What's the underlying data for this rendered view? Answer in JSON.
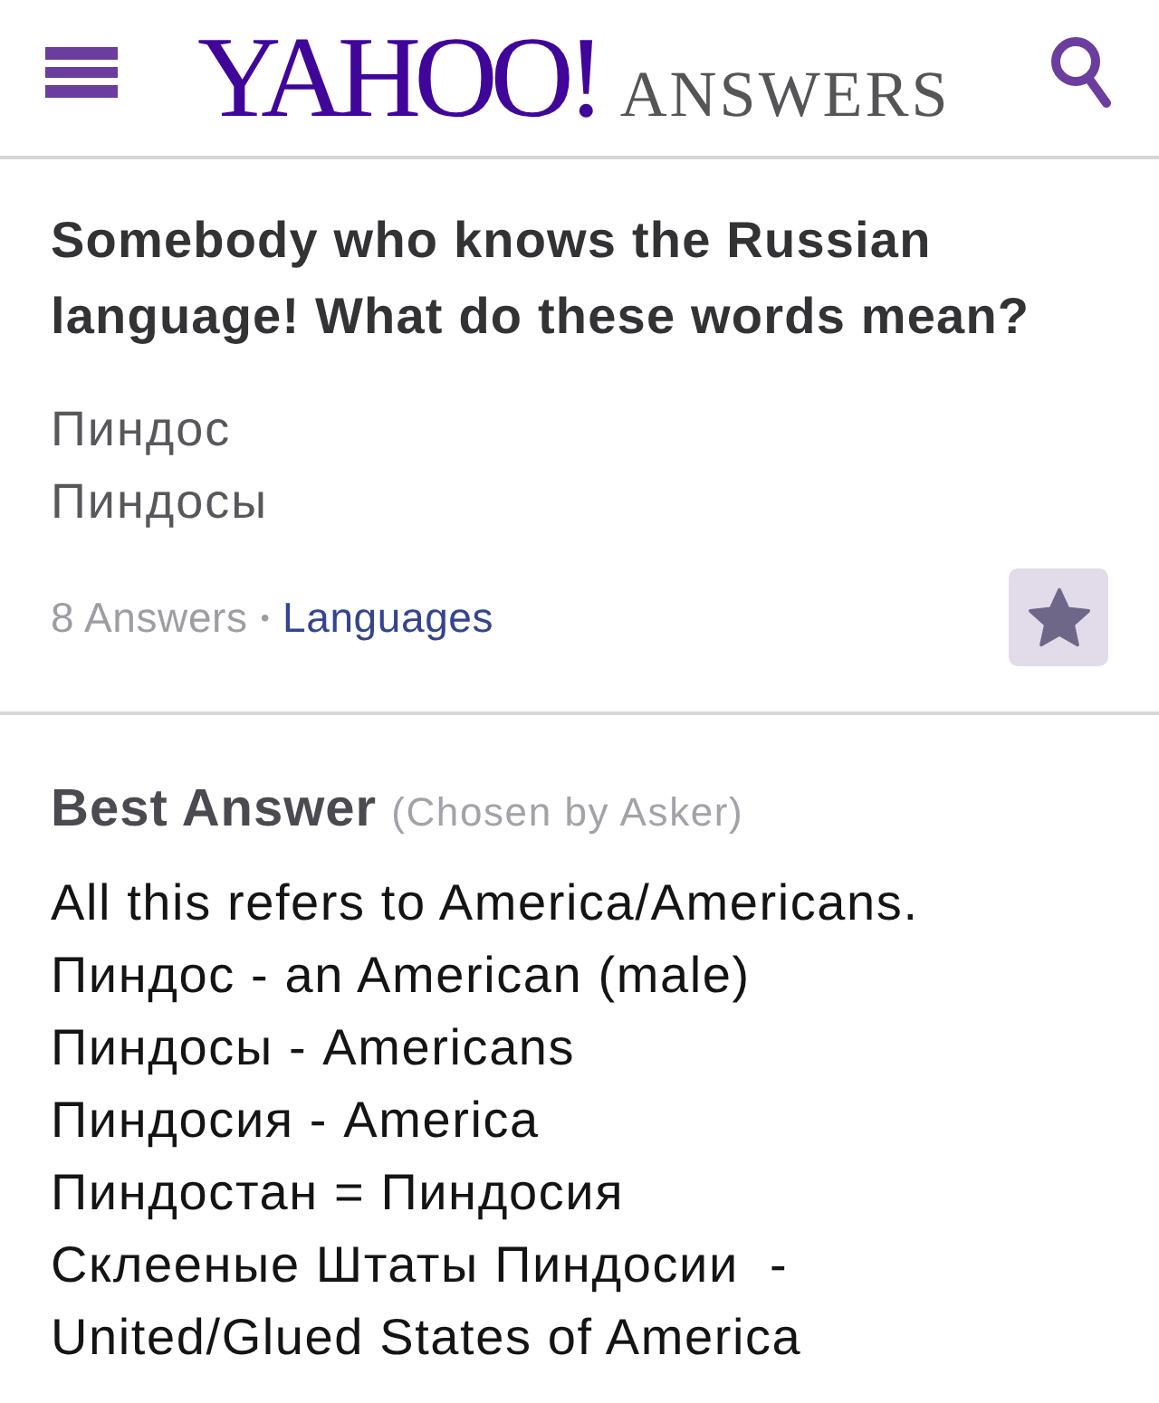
{
  "header": {
    "logo": "YAHOO!",
    "product": "ANSWERS"
  },
  "question": {
    "title": "Somebody who knows the Russian language! What do these words mean?",
    "body": [
      "Пиндос",
      "Пиндосы"
    ],
    "answer_count": "8 Answers",
    "separator": "•",
    "category": "Languages"
  },
  "best_answer": {
    "heading": "Best Answer",
    "note": "(Chosen by Asker)",
    "lines": [
      "All this refers to America/Americans.",
      "Пиндос - an American (male)",
      "Пиндосы - Americans",
      "Пиндосия - America",
      "Пиндостан = Пиндосия",
      "Склееные Штаты Пиндосии  -",
      "United/Glued States of America"
    ]
  }
}
